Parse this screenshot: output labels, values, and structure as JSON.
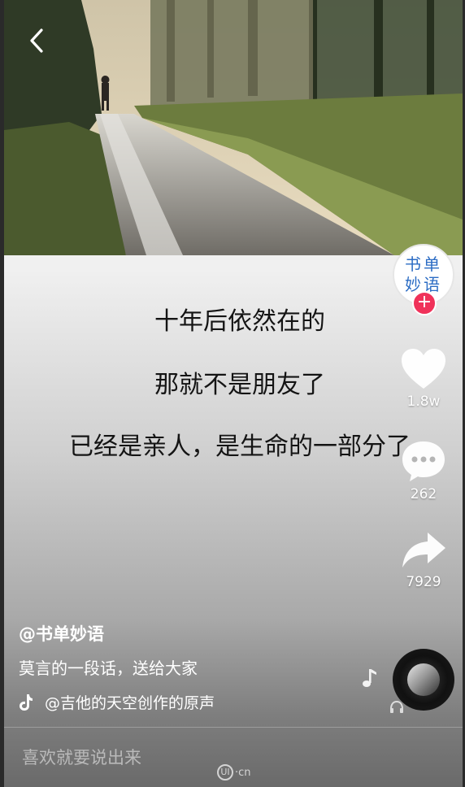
{
  "caption": {
    "line1": "十年后依然在的",
    "line2": "那就不是朋友了",
    "line3": "已经是亲人，是生命的一部分了"
  },
  "creator": {
    "avatar_line1": "书单",
    "avatar_line2": "妙语",
    "follow_label": "+"
  },
  "actions": {
    "likes": "1.8w",
    "comments": "262",
    "shares": "7929"
  },
  "post": {
    "author": "@书单妙语",
    "description": "莫言的一段话，送给大家",
    "music": "@吉他的天空创作的原声"
  },
  "comment_box": {
    "placeholder": "喜欢就要说出来"
  },
  "watermark": {
    "mark": "UI",
    "suffix": "·cn"
  },
  "colors": {
    "follow_red": "#f0325a",
    "avatar_text_blue": "#2b6cc4"
  },
  "icons": [
    "back-arrow-icon",
    "heart-icon",
    "comment-bubble-icon",
    "share-arrow-icon",
    "tiktok-logo-icon",
    "music-note-icon",
    "music-disc-icon"
  ]
}
